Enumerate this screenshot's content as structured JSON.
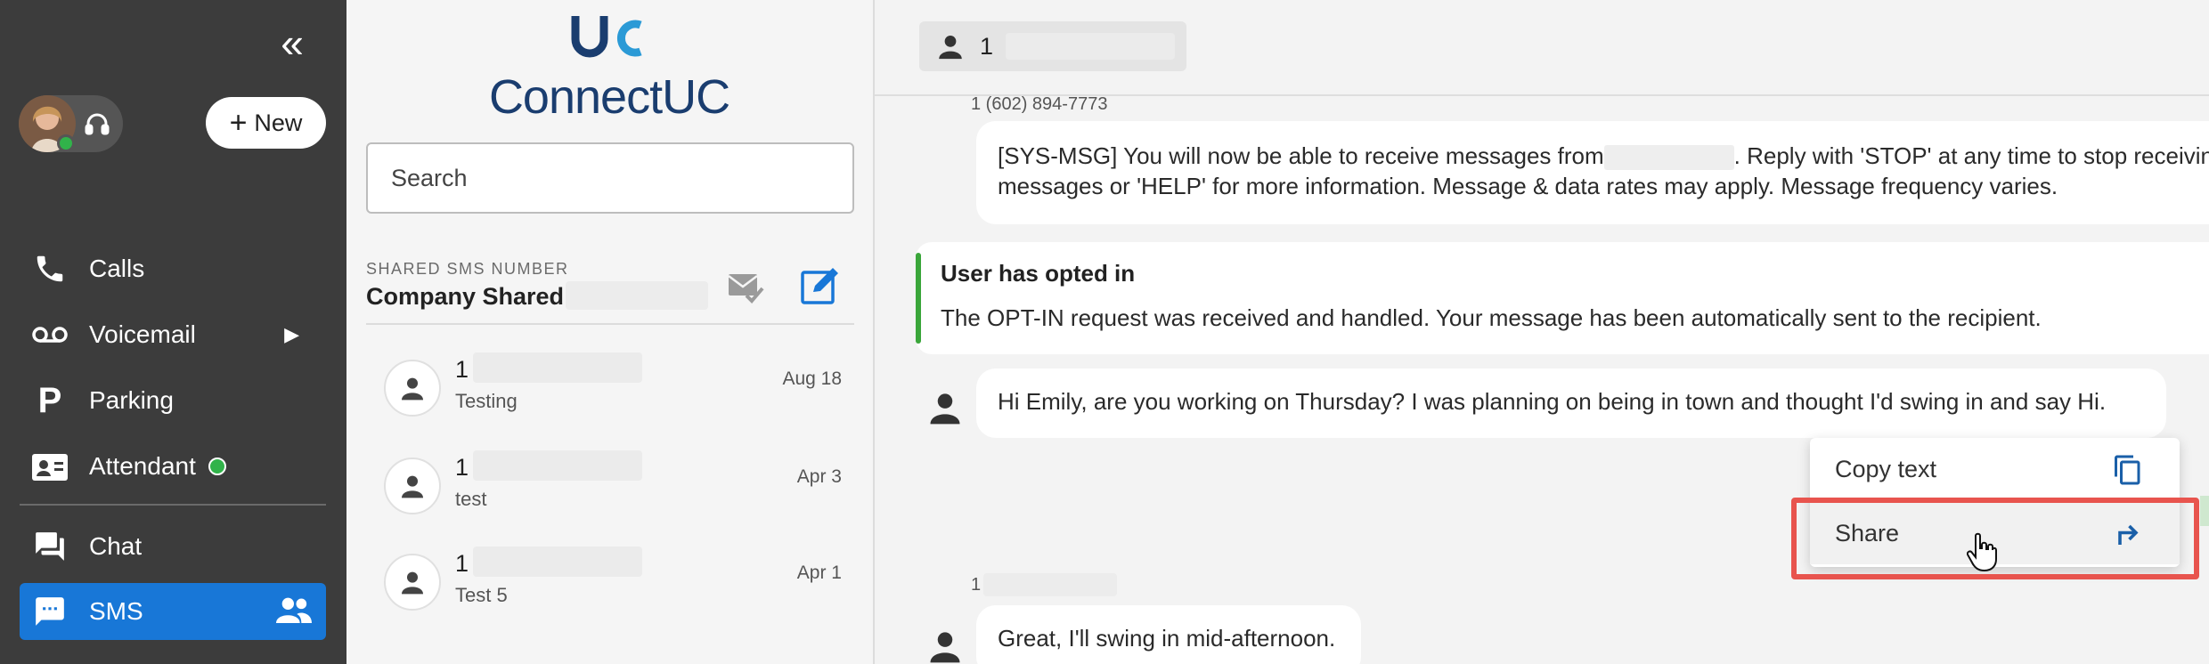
{
  "nav": {
    "new_label": "New",
    "items": [
      {
        "id": "calls",
        "label": "Calls",
        "icon": "phone-icon"
      },
      {
        "id": "voicemail",
        "label": "Voicemail",
        "icon": "voicemail-icon"
      },
      {
        "id": "parking",
        "label": "Parking",
        "icon": "parking-icon"
      },
      {
        "id": "attendant",
        "label": "Attendant",
        "icon": "attendant-icon"
      },
      {
        "id": "chat",
        "label": "Chat",
        "icon": "chat-icon"
      },
      {
        "id": "sms",
        "label": "SMS",
        "icon": "sms-icon",
        "active": true
      }
    ],
    "accent": "#1877d7",
    "presence_color": "#31b34a"
  },
  "list": {
    "logo_text": "ConnectUC",
    "search_placeholder": "Search",
    "shared_label": "SHARED SMS NUMBER",
    "shared_name": "Company Shared",
    "conversations": [
      {
        "name": "1",
        "preview": "Testing",
        "date": "Aug 18"
      },
      {
        "name": "1",
        "preview": "test",
        "date": "Apr 3"
      },
      {
        "name": "1",
        "preview": "Test 5",
        "date": "Apr 1"
      }
    ]
  },
  "chat": {
    "contact": "1",
    "messages": {
      "sys_sender": "1 (602) 894-7773",
      "sys_line1_a": "[SYS-MSG] You will now be able to receive messages from",
      "sys_line1_b": ". Reply with 'STOP' at any time to stop receiving",
      "sys_line2": "messages or 'HELP' for more information. Message & data rates may apply. Message frequency varies.",
      "optin_title": "User has opted in",
      "optin_body": "The OPT-IN request was received and handled. Your message has been automatically sent to the recipient.",
      "msg1": "Hi Emily, are you working on Thursday? I was planning on being in town and thought I'd swing in and say Hi.",
      "msg2_sender": "1",
      "msg2": "Great, I'll swing in mid-afternoon."
    },
    "menu": {
      "copy_label": "Copy text",
      "share_label": "Share"
    },
    "highlight_color": "#e8544e"
  }
}
